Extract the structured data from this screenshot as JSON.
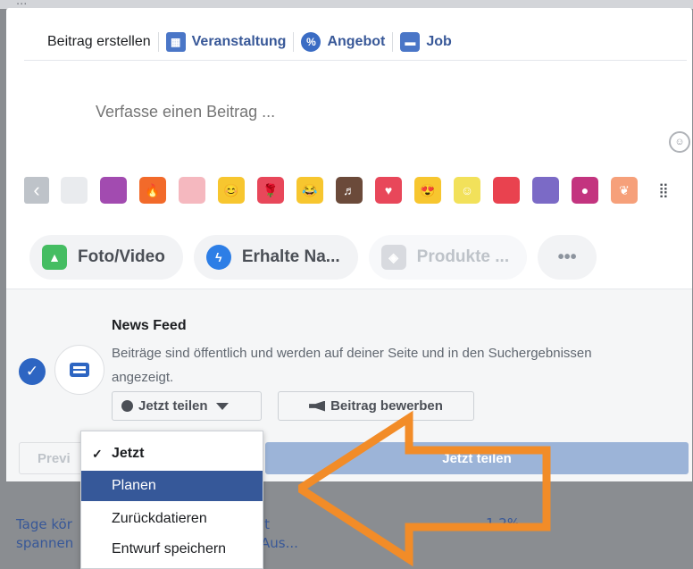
{
  "colors": {
    "link_blue": "#385898",
    "brand_blue": "#2d65c2",
    "selected_row": "#365899",
    "arrow_orange": "#f28c28"
  },
  "tabs": [
    {
      "label": "Beitrag erstellen",
      "icon": null,
      "active": true
    },
    {
      "label": "Veranstaltung",
      "icon": "calendar-icon",
      "active": false
    },
    {
      "label": "Angebot",
      "icon": "percent-badge-icon",
      "active": false
    },
    {
      "label": "Job",
      "icon": "briefcase-icon",
      "active": false
    }
  ],
  "composer": {
    "placeholder": "Verfasse einen Beitrag ..."
  },
  "swatches": [
    {
      "name": "swatch-white",
      "color": "#e9ebee",
      "glyph": ""
    },
    {
      "name": "swatch-purple",
      "color": "#a24bb0",
      "glyph": ""
    },
    {
      "name": "swatch-fire",
      "color": "#f26a2a",
      "glyph": "🔥"
    },
    {
      "name": "swatch-pink",
      "color": "#f5b8bf",
      "glyph": ""
    },
    {
      "name": "swatch-smiley",
      "color": "#f7c62f",
      "glyph": "😊"
    },
    {
      "name": "swatch-rose",
      "color": "#e8475a",
      "glyph": "🌹"
    },
    {
      "name": "swatch-laugh",
      "color": "#f7c62f",
      "glyph": "😂"
    },
    {
      "name": "swatch-brown",
      "color": "#6b4a3a",
      "glyph": "♬"
    },
    {
      "name": "swatch-heart",
      "color": "#e8475a",
      "glyph": "♥"
    },
    {
      "name": "swatch-heart-eyes",
      "color": "#f7c62f",
      "glyph": "😍"
    },
    {
      "name": "swatch-yellow",
      "color": "#f2e15a",
      "glyph": "☺"
    },
    {
      "name": "swatch-red",
      "color": "#e9424f",
      "glyph": ""
    },
    {
      "name": "swatch-violet",
      "color": "#7b6ac6",
      "glyph": ""
    },
    {
      "name": "swatch-gradient",
      "color": "#c3347f",
      "glyph": "●"
    },
    {
      "name": "swatch-peach",
      "color": "#f6a07a",
      "glyph": "❦"
    }
  ],
  "actions": {
    "photo": "Foto/Video",
    "messenger": "Erhalte Na...",
    "products": "Produkte ...",
    "more": "•••"
  },
  "news_feed": {
    "title": "News Feed",
    "description": "Beiträge sind öffentlich und werden auf deiner Seite und in den Suchergebnissen angezeigt."
  },
  "buttons": {
    "share_now": "Jetzt teilen",
    "promote": "Beitrag bewerben",
    "preview": "Previ",
    "share_now_main": "Jetzt teilen"
  },
  "dropdown": {
    "items": [
      {
        "label": "Jetzt",
        "checked": true,
        "selected": false
      },
      {
        "label": "Planen",
        "checked": false,
        "selected": true
      },
      {
        "label": "Zurückdatieren",
        "checked": false,
        "selected": false
      },
      {
        "label": "Entwurf speichern",
        "checked": false,
        "selected": false
      }
    ]
  },
  "background_page": {
    "top_text": "...",
    "left_line1": "Tage kör",
    "left_line2": "spannen",
    "right_line1": "it",
    "right_line2": "Aus...",
    "number": "1,2%"
  }
}
